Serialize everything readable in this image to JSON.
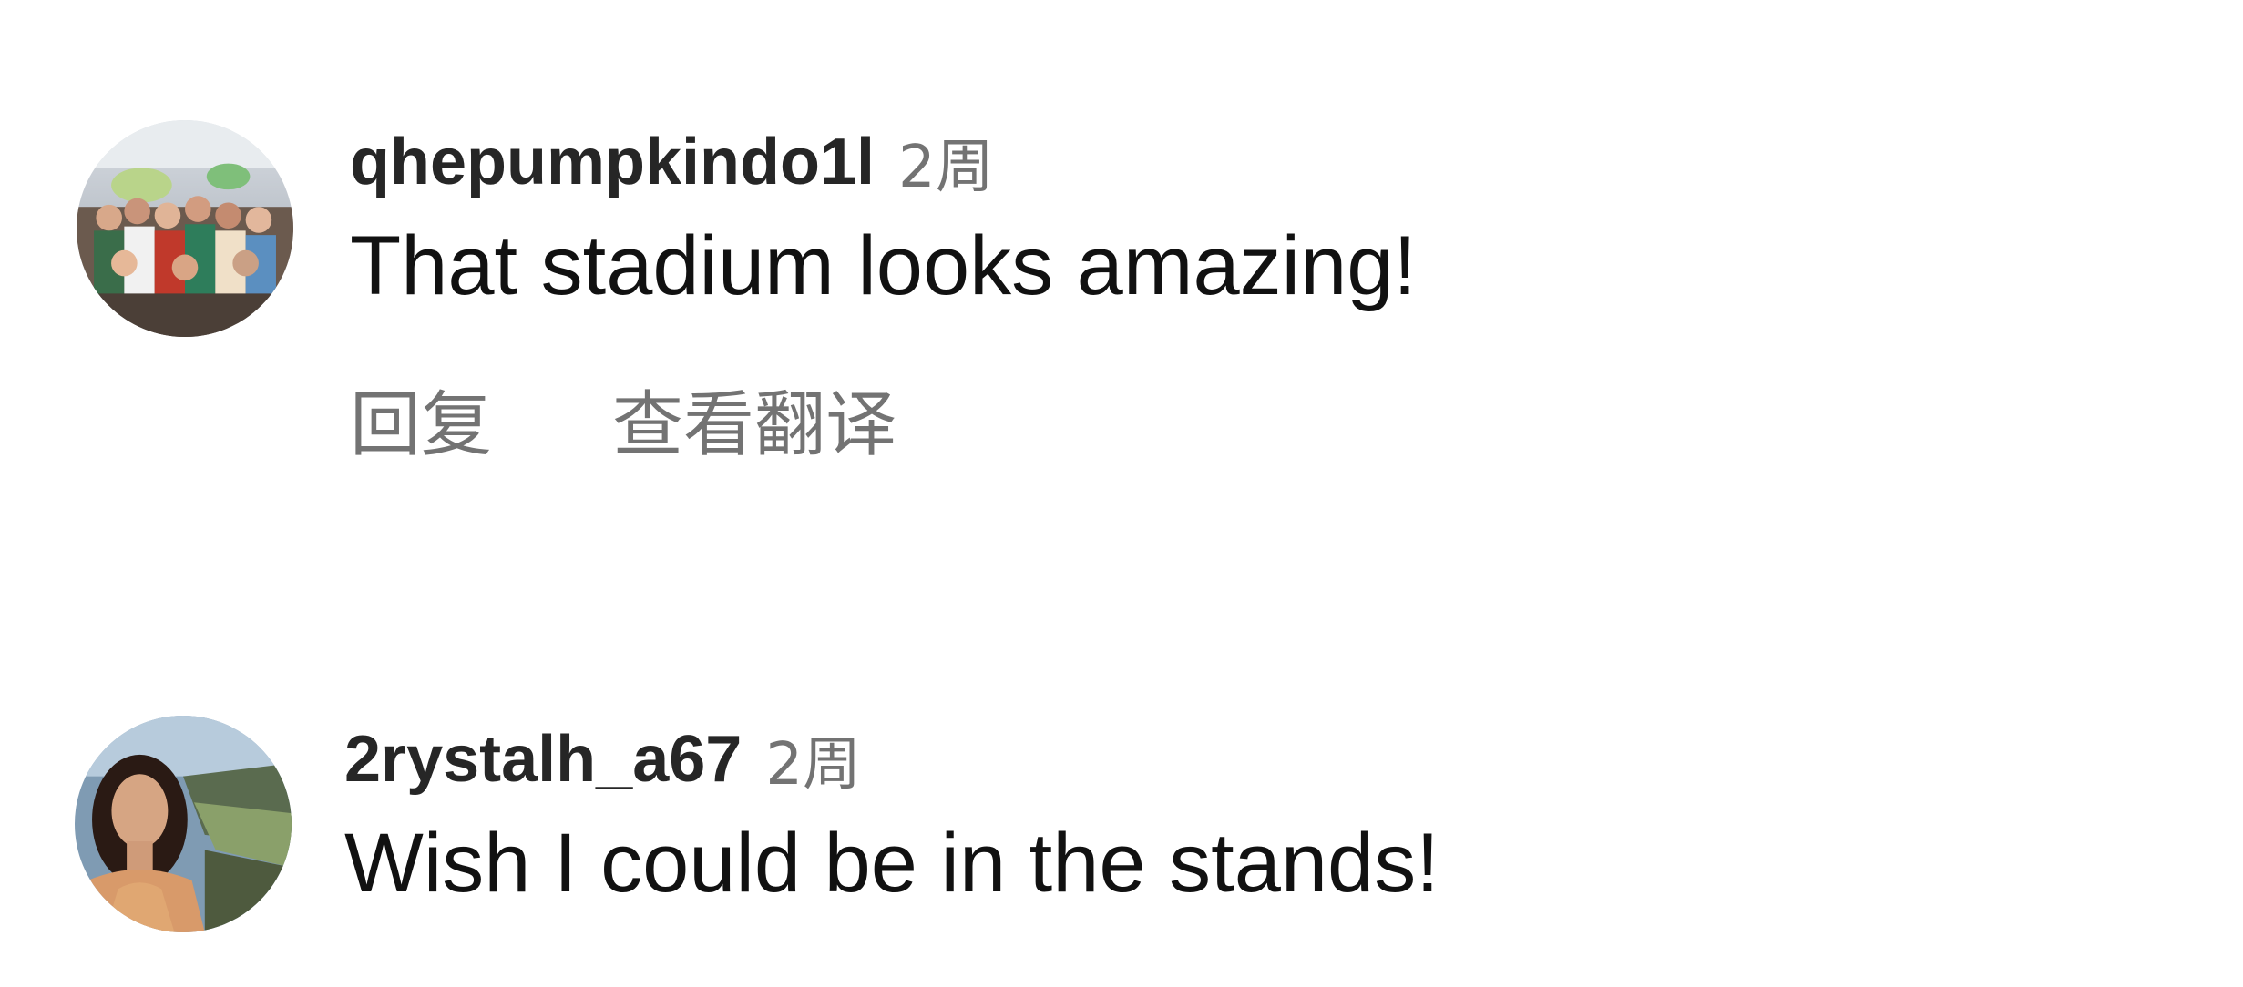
{
  "comments": [
    {
      "username": "qhepumpkindo1l",
      "time": "2周",
      "text": "That stadium looks amazing!",
      "actions": {
        "reply": "回复",
        "translate": "查看翻译"
      },
      "avatar_icon": "group-photo-avatar"
    },
    {
      "username": "2rystalh_a67",
      "time": "2周",
      "text": "Wish I could be in the stands!",
      "avatar_icon": "portrait-photo-avatar"
    }
  ],
  "colors": {
    "username": "#262626",
    "secondary_text": "#737373",
    "body_text": "#111111",
    "background": "#ffffff"
  }
}
